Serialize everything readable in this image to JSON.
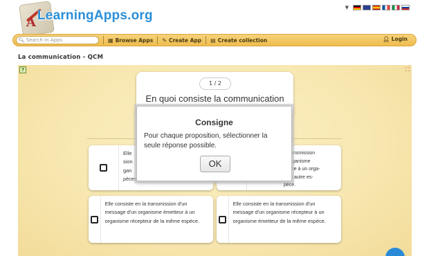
{
  "header": {
    "logo_text": "LearningApps.org",
    "logo_letter": "A"
  },
  "languages": [
    "de",
    "en",
    "es",
    "fr",
    "it",
    "ru"
  ],
  "navbar": {
    "search_placeholder": "Search in Apps",
    "browse_label": "Browse Apps",
    "create_label": "Create App",
    "collection_label": "Create collection",
    "login_label": "Login"
  },
  "page": {
    "title": "La communication - QCM"
  },
  "quiz": {
    "counter": "1 / 2",
    "question": "En quoi consiste la communication",
    "answers": [
      {
        "text": "Elle consiste en la transmission d'un message d'un organisme émetteur à un organisme récepteur d'une autre espèces."
      },
      {
        "text": "Elle consiste en la transmission d'un message d'un organisme récepteur d'une espèce à un organisme émetteur d'une autre espèce."
      },
      {
        "text": "Elle consiste en la transmission d'un message d'un organisme émetteur à un organisme récepteur de la même espèce."
      },
      {
        "text": "Elle consiste en la transmission d'un message d'un organisme récepteur à un organisme émetteur de la même espèce."
      }
    ],
    "a1_visible": [
      "Elle",
      "sion",
      "gan",
      "pèces."
    ],
    "a2_visible": [
      "a transmission",
      "n organisme",
      "spèce à un orga-",
      "'une autre es-",
      "pèce."
    ]
  },
  "modal": {
    "title": "Consigne",
    "body": "Pour chaque proposition, sélectionner la seule réponse possible.",
    "ok_label": "OK"
  },
  "colors": {
    "accent": "#2b8fd8",
    "navbar": "#eebd4f",
    "app_background": "#f7e6ae"
  }
}
